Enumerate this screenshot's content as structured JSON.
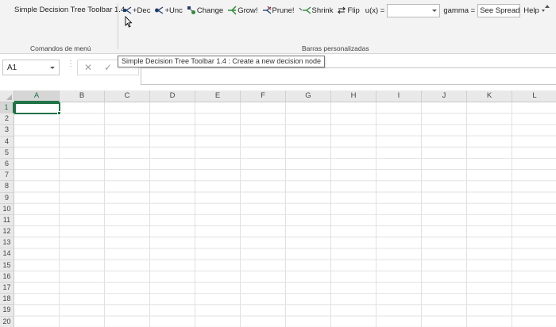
{
  "ribbon": {
    "menu_title": "Simple Decision Tree Toolbar 1.4",
    "menu_group_label": "Comandos de menú",
    "bars_group_label": "Barras personalizadas",
    "buttons": [
      {
        "label": "+Dec",
        "icon": "decision-node-icon"
      },
      {
        "label": "+Unc",
        "icon": "uncertainty-node-icon"
      },
      {
        "label": "Change",
        "icon": "change-node-icon"
      },
      {
        "label": "Grow!",
        "icon": "grow-tree-icon"
      },
      {
        "label": "Prune!",
        "icon": "prune-tree-icon"
      },
      {
        "label": "Shrink",
        "icon": "shrink-tree-icon"
      },
      {
        "label": "Flip",
        "icon": "flip-arrows-icon"
      }
    ],
    "ux_label": "u(x) =",
    "ux_value": "",
    "gamma_label": "gamma =",
    "gamma_value": "See Spreadshe",
    "help_label": "Help"
  },
  "tooltip": "Simple Decision Tree Toolbar 1.4 : Create a new decision node",
  "formula_bar": {
    "name_box": "A1",
    "formula": ""
  },
  "sheet": {
    "columns": [
      "A",
      "B",
      "C",
      "D",
      "E",
      "F",
      "G",
      "H",
      "I",
      "J",
      "K",
      "L"
    ],
    "rows": [
      "1",
      "2",
      "3",
      "4",
      "5",
      "6",
      "7",
      "8",
      "9",
      "10",
      "11",
      "12",
      "13",
      "14",
      "15",
      "16",
      "17",
      "18",
      "19",
      "20"
    ],
    "selected_cell": "A1"
  },
  "colors": {
    "excel_green": "#217346",
    "ribbon_bg": "#f3f3f3"
  }
}
